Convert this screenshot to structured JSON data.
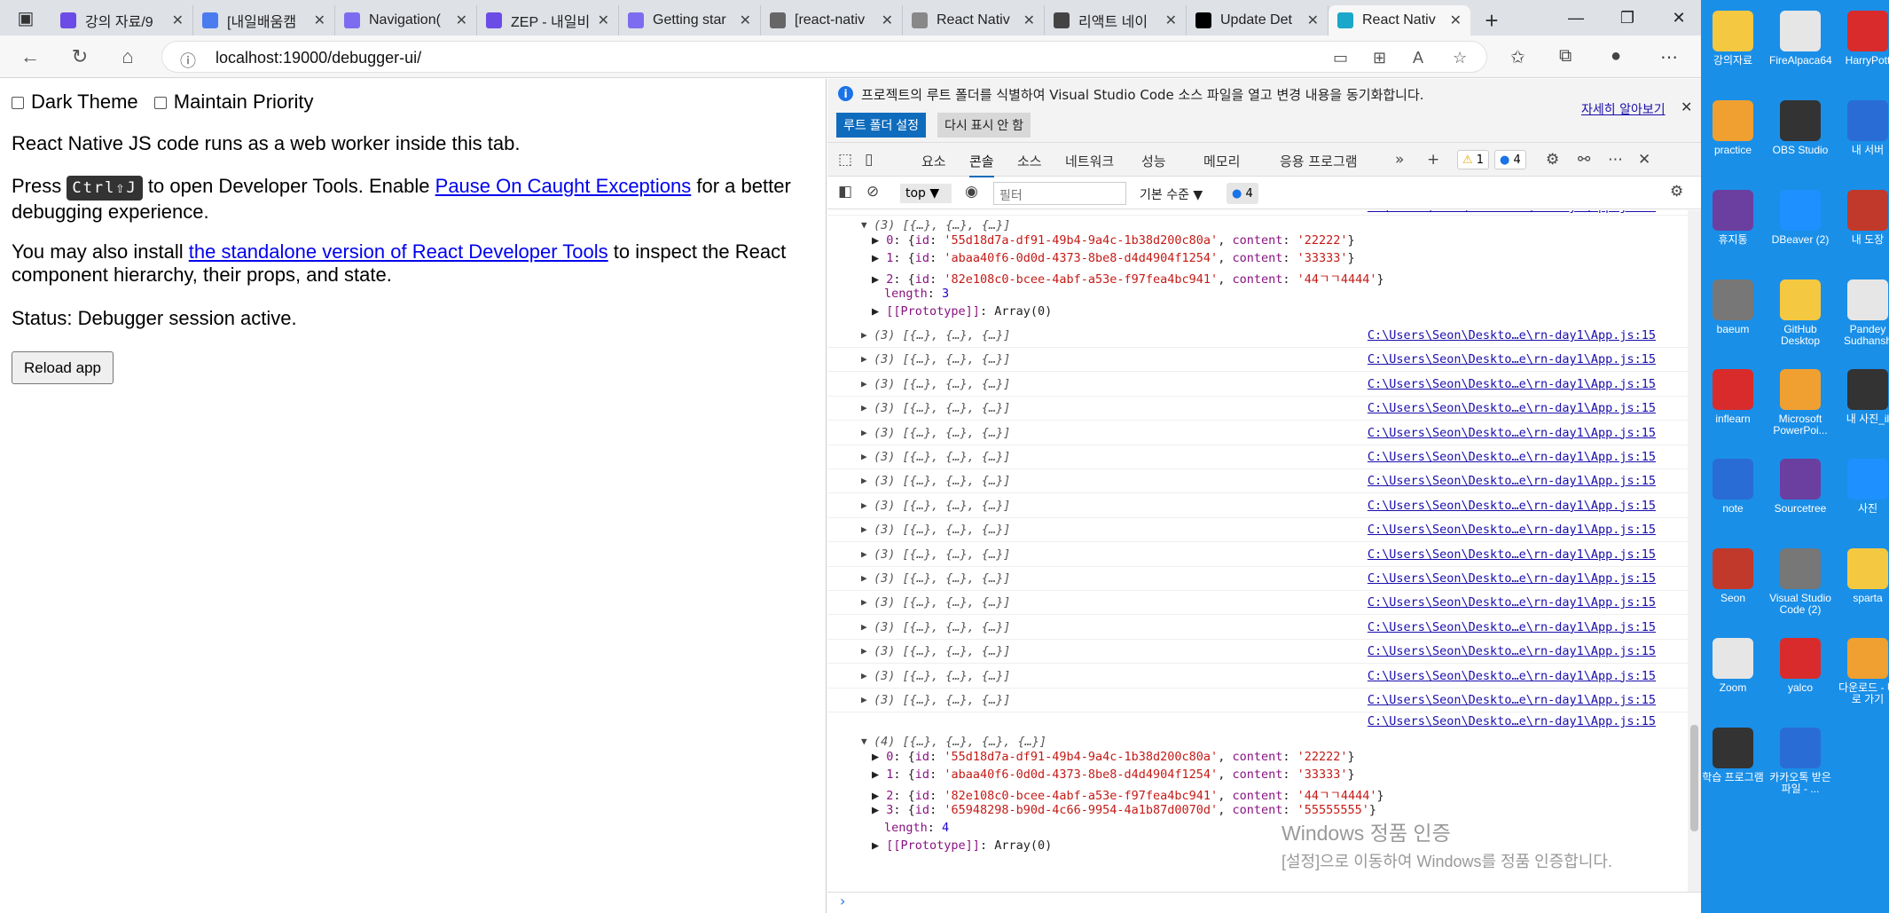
{
  "browser": {
    "tabs": [
      {
        "label": "강의 자료/9",
        "icon": "folder-icon",
        "color": "#6b4ce6"
      },
      {
        "label": "[내일배움캠",
        "icon": "zep-z-icon",
        "color": "#4a7cf0"
      },
      {
        "label": "Navigation(",
        "icon": "globe-icon",
        "color": "#7d6cf0"
      },
      {
        "label": "ZEP - 내일비",
        "icon": "zep-icon",
        "color": "#6b4ce6"
      },
      {
        "label": "Getting star",
        "icon": "globe-icon",
        "color": "#7d6cf0"
      },
      {
        "label": "[react-nativ",
        "icon": "dots-icon",
        "color": "#666666"
      },
      {
        "label": "React Nativ",
        "icon": "page-icon",
        "color": "#888888"
      },
      {
        "label": "리액트 네이",
        "icon": "dots-icon",
        "color": "#444444"
      },
      {
        "label": "Update Det",
        "icon": "expo-icon",
        "color": "#000000"
      },
      {
        "label": "React Nativ",
        "icon": "react-icon",
        "color": "#1aa7c9",
        "active": true
      }
    ],
    "url": "localhost:19000/debugger-ui/"
  },
  "page": {
    "dark_theme_label": "Dark Theme",
    "maintain_priority_label": "Maintain Priority",
    "intro": "React Native JS code runs as a web worker inside this tab.",
    "press": "Press",
    "shortcut": "Ctrl⇧J",
    "press_middle": "to open Developer Tools. Enable",
    "pause_link": "Pause On Caught Exceptions",
    "press_end": "for a better",
    "press_line2": "debugging experience.",
    "install_start": "You may also install",
    "install_link": "the standalone version of React Developer Tools",
    "install_end": "to inspect the React",
    "install_line2": "component hierarchy, their props, and state.",
    "status": "Status: Debugger session active.",
    "reload_button": "Reload app"
  },
  "devtools": {
    "info_text": "프로젝트의 루트 폴더를 식별하여 Visual Studio Code 소스 파일을 열고 변경 내용을 동기화합니다.",
    "info_link": "자세히 알아보기",
    "btn_root": "루트 폴더 설정",
    "btn_hide": "다시 표시 안 함",
    "tabs": [
      "요소",
      "콘솔",
      "소스",
      "네트워크",
      "성능",
      "메모리",
      "응용 프로그램"
    ],
    "warn_count": "1",
    "msg_count": "4",
    "context": "top",
    "filter_placeholder": "필터",
    "levels": "기본 수준",
    "badge_count": "4",
    "source": "C:\\Users\\Seon\\Deskto…e\\rn-day1\\App.js:15",
    "collapsed_summary": "(3) [{…}, {…}, {…}]",
    "first_group": {
      "summary": "(3) [{…}, {…}, {…}]",
      "items": [
        {
          "idx": "0",
          "id": "'55d18d7a-df91-49b4-9a4c-1b38d200c80a'",
          "content": "'22222'"
        },
        {
          "idx": "1",
          "id": "'abaa40f6-0d0d-4373-8be8-d4d4904f1254'",
          "content": "'33333'"
        },
        {
          "idx": "2",
          "id": "'82e108c0-bcee-4abf-a53e-f97fea4bc941'",
          "content": "'44ㄱㄱ4444'"
        }
      ],
      "length": "3",
      "proto": "Array(0)"
    },
    "last_group": {
      "summary": "(4) [{…}, {…}, {…}, {…}]",
      "items": [
        {
          "idx": "0",
          "id": "'55d18d7a-df91-49b4-9a4c-1b38d200c80a'",
          "content": "'22222'"
        },
        {
          "idx": "1",
          "id": "'abaa40f6-0d0d-4373-8be8-d4d4904f1254'",
          "content": "'33333'"
        },
        {
          "idx": "2",
          "id": "'82e108c0-bcee-4abf-a53e-f97fea4bc941'",
          "content": "'44ㄱㄱ4444'"
        },
        {
          "idx": "3",
          "id": "'65948298-b90d-4c66-9954-4a1b87d0070d'",
          "content": "'55555555'"
        }
      ],
      "length": "4",
      "proto": "Array(0)"
    }
  },
  "watermark": {
    "title": "Windows 정품 인증",
    "subtitle": "[설정]으로 이동하여 Windows를 정품 인증합니다."
  },
  "desktop": {
    "icons": [
      "강의자료",
      "FireAlpaca64",
      "HarryPott",
      "practice",
      "OBS Studio",
      "내 서버",
      "휴지통",
      "DBeaver (2)",
      "내 도장",
      "baeum",
      "GitHub Desktop",
      "Pandey Sudhansh",
      "inflearn",
      "Microsoft PowerPoi...",
      "내 사진_il",
      "note",
      "Sourcetree",
      "사진",
      "Seon",
      "Visual Studio Code (2)",
      "sparta",
      "Zoom",
      "yalco",
      "다운로드 - 바로 가기",
      "학습 프로그램",
      "카카오톡 받은 파일 - ..."
    ]
  }
}
